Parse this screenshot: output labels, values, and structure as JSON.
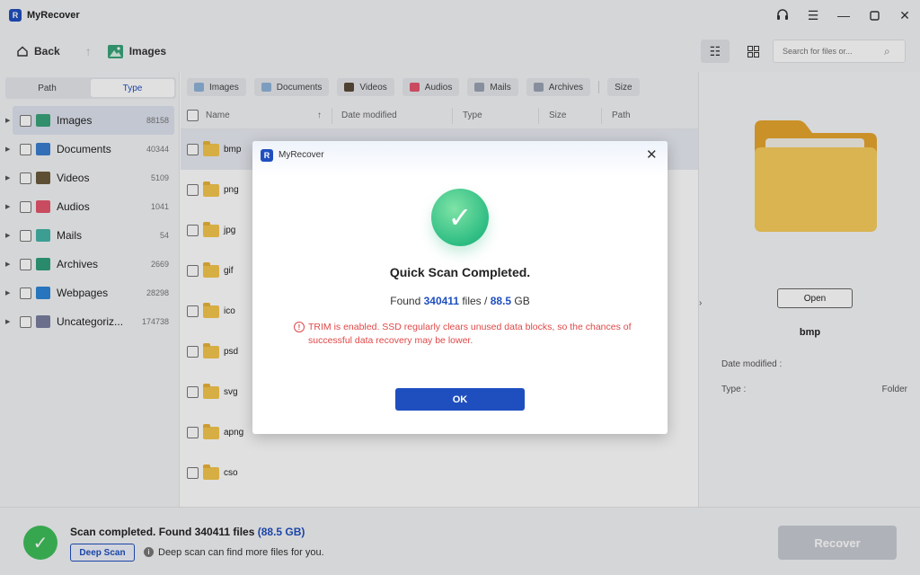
{
  "app": {
    "title": "MyRecover"
  },
  "toolbar": {
    "back_label": "Back",
    "crumb_label": "Images",
    "search_placeholder": "Search for files or..."
  },
  "left": {
    "tabs": [
      {
        "label": "Path"
      },
      {
        "label": "Type"
      }
    ],
    "items": [
      {
        "label": "Images",
        "count": "88158",
        "icon": "images-icon",
        "color": "#3aa37a"
      },
      {
        "label": "Documents",
        "count": "40344",
        "icon": "documents-icon",
        "color": "#3b7fd1"
      },
      {
        "label": "Videos",
        "count": "5109",
        "icon": "videos-icon",
        "color": "#6b5a3c"
      },
      {
        "label": "Audios",
        "count": "1041",
        "icon": "audios-icon",
        "color": "#e4566e"
      },
      {
        "label": "Mails",
        "count": "54",
        "icon": "mails-icon",
        "color": "#45b3a8"
      },
      {
        "label": "Archives",
        "count": "2669",
        "icon": "archives-icon",
        "color": "#2f9f7a"
      },
      {
        "label": "Webpages",
        "count": "28298",
        "icon": "webpages-icon",
        "color": "#2d86d6"
      },
      {
        "label": "Uncategoriz...",
        "count": "174738",
        "icon": "uncategorized-icon",
        "color": "#7a7fa0"
      }
    ]
  },
  "filters": [
    {
      "label": "Images",
      "color": "#8fb3d9"
    },
    {
      "label": "Documents",
      "color": "#8fb3d9"
    },
    {
      "label": "Videos",
      "color": "#5a4a3a"
    },
    {
      "label": "Audios",
      "color": "#e4566e"
    },
    {
      "label": "Mails",
      "color": "#9aa3b3"
    },
    {
      "label": "Archives",
      "color": "#9aa3b3"
    },
    {
      "label": "Size",
      "color": ""
    }
  ],
  "columns": {
    "name": "Name",
    "date": "Date modified",
    "type": "Type",
    "size": "Size",
    "path": "Path"
  },
  "files": [
    {
      "name": "bmp"
    },
    {
      "name": "png"
    },
    {
      "name": "jpg"
    },
    {
      "name": "gif"
    },
    {
      "name": "ico"
    },
    {
      "name": "psd"
    },
    {
      "name": "svg"
    },
    {
      "name": "apng"
    },
    {
      "name": "cso"
    }
  ],
  "preview": {
    "open_label": "Open",
    "name": "bmp",
    "date_label": "Date modified :",
    "type_label": "Type :",
    "type_value": "Folder"
  },
  "status": {
    "prefix": "Scan completed. Found 340411 files",
    "size": "(88.5 GB)",
    "deep_scan_label": "Deep Scan",
    "hint": "Deep scan can find more files for you.",
    "recover_label": "Recover"
  },
  "dialog": {
    "title": "MyRecover",
    "heading": "Quick Scan Completed.",
    "found_prefix": "Found",
    "files_count": "340411",
    "files_word": "files",
    "sep": "/",
    "size_value": "88.5",
    "size_unit": "GB",
    "warning": "TRIM is enabled. SSD regularly clears unused data blocks, so the chances of successful data recovery may be lower.",
    "ok_label": "OK"
  },
  "colors": {
    "accent": "#1f4fbf",
    "success": "#3fbf5a",
    "warning": "#e04848"
  }
}
